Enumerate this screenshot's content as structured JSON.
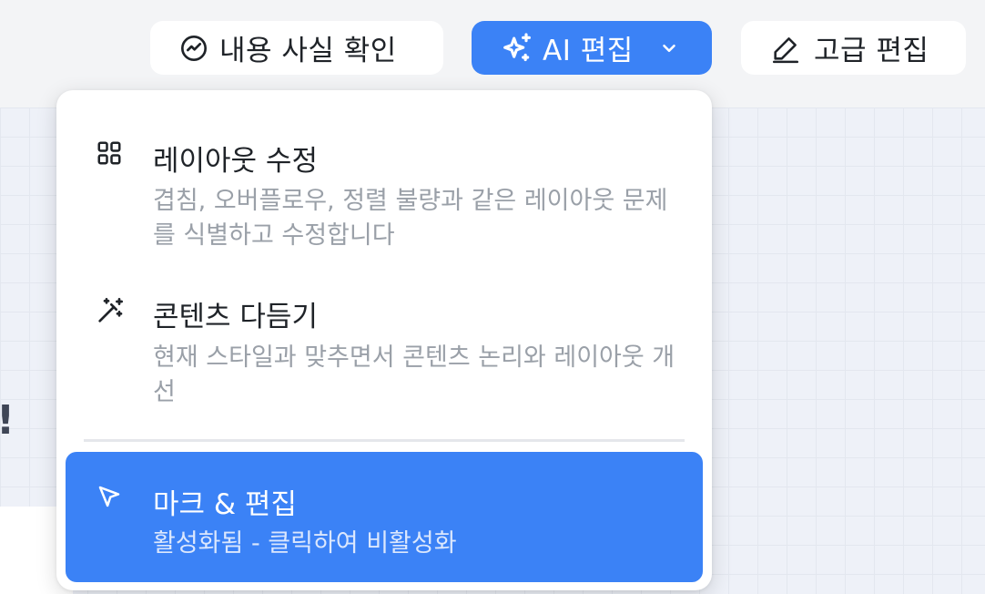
{
  "toolbar": {
    "fact_check_label": "내용 사실 확인",
    "ai_edit_label": "AI 편집",
    "advanced_edit_label": "고급 편집"
  },
  "canvas": {
    "partial_text": "!"
  },
  "menu": {
    "items": [
      {
        "icon": "layout-grid-icon",
        "title": "레이아웃 수정",
        "description": "겹침, 오버플로우, 정렬 불량과 같은 레이아웃 문제를 식별하고 수정합니다"
      },
      {
        "icon": "magic-wand-icon",
        "title": "콘텐츠 다듬기",
        "description": "현재 스타일과 맞추면서 콘텐츠 논리와 레이아웃 개선"
      },
      {
        "icon": "cursor-pointer-icon",
        "title": "마크 & 편집",
        "description": "활성화됨 - 클릭하여 비활성화",
        "active": true
      }
    ]
  },
  "colors": {
    "accent": "#3b82f6",
    "toolbar_bg": "#f3f4f6",
    "text_primary": "#1f2328",
    "text_secondary": "#9aa0a8"
  }
}
